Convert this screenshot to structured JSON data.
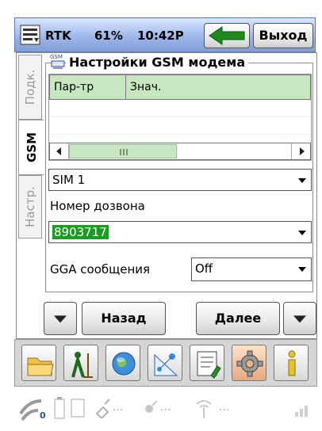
{
  "title_bar": {
    "rtk_label": "RTK",
    "battery": "61%",
    "time": "10:42P",
    "exit_label": "Выход"
  },
  "side_tabs": [
    "Подк.",
    "GSM",
    "Настр."
  ],
  "frame": {
    "title": "Настройки GSM модема"
  },
  "grid": {
    "columns": [
      "Пар-тр",
      "Знач."
    ]
  },
  "sim": {
    "value": "SIM 1"
  },
  "dial": {
    "label": "Номер дозвона",
    "value": "8903717"
  },
  "gga": {
    "label": "GGA сообщения",
    "value": "Off"
  },
  "nav": {
    "back_label": "Назад",
    "next_label": "Далее"
  },
  "toolbar_icons": [
    "folder-icon",
    "surveyor-icon",
    "globe-icon",
    "geometry-icon",
    "notes-icon",
    "settings-gear-icon",
    "info-icon"
  ],
  "status": {
    "link_dots": "...",
    "sub": "0"
  },
  "colors": {
    "header_green": "#c6e7bf",
    "highlight_green": "#1e9b25",
    "title_bar_blue": "#9fb7ea"
  }
}
